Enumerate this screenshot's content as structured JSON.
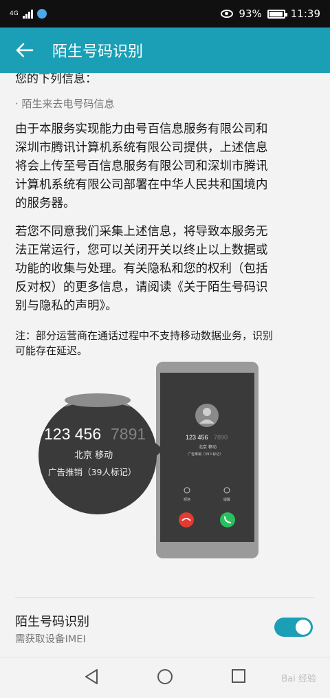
{
  "status": {
    "network": "4G",
    "battery_text": "93%",
    "time": "11:39"
  },
  "header": {
    "title": "陌生号码识别",
    "back_icon": "arrow-left-icon"
  },
  "content": {
    "clipped_line": "您的下列信息：",
    "bullet": "· 陌生来去电号码信息",
    "paragraph1_lines": [
      "由于本服务实现能力由号百信息服务有限公司和",
      "深圳市腾讯计算机系统有限公司提供，上述信息",
      "将会上传至号百信息服务有限公司和深圳市腾讯",
      "计算机系统有限公司部署在中华人民共和国境内",
      "的服务器。"
    ],
    "paragraph2_lines": [
      "若您不同意我们采集上述信息，将导致本服务无",
      "法正常运行，您可以关闭开关以终止以上数据或",
      "功能的收集与处理。有关隐私和您的权利（包括",
      "反对权）的更多信息，请阅读《关于陌生号码识",
      "别与隐私的声明》。"
    ],
    "note_lines": [
      "注：部分运营商在通话过程中不支持移动数据业务，识别",
      "可能存在延迟。"
    ]
  },
  "illustration": {
    "zoom_number": "123 456",
    "zoom_number_blur": "7891",
    "zoom_location": "北京 移动",
    "zoom_tag": "广告推销（39人标记）",
    "phone_number": "123 456",
    "phone_number_blur": "7890",
    "phone_location": "北京 移动",
    "phone_tag": "广告推销（39人标记）",
    "phone_msg_label": "短信",
    "phone_remind_label": "提醒"
  },
  "setting": {
    "title": "陌生号码识别",
    "subtitle": "需获取设备IMEI",
    "toggle_on": true,
    "accent": "#1a9fb6"
  },
  "watermark": "Bai 经验"
}
